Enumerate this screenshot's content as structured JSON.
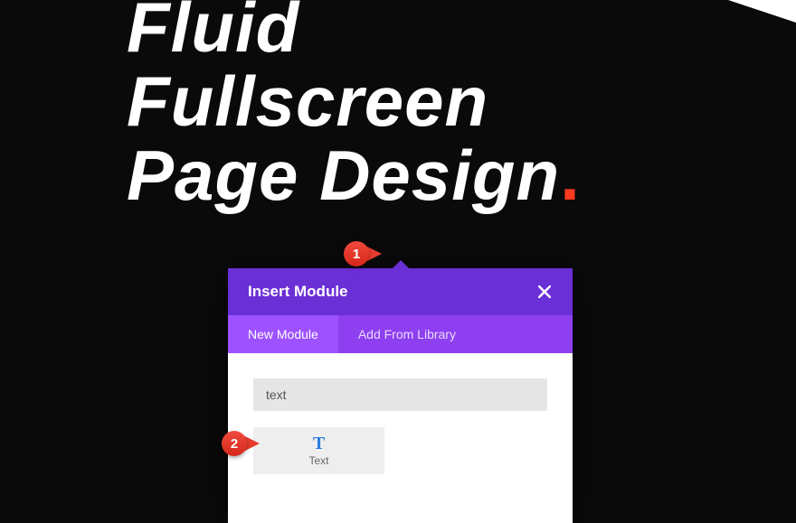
{
  "hero": {
    "line1": "Fluid",
    "line2": "Fullscreen",
    "line3": "Page Design",
    "punct": "."
  },
  "modal": {
    "title": "Insert Module",
    "tabs": {
      "new": "New Module",
      "library": "Add From Library"
    },
    "search_value": "text",
    "modules": {
      "text": {
        "icon": "T",
        "label": "Text"
      }
    }
  },
  "callouts": {
    "c1": "1",
    "c2": "2"
  },
  "colors": {
    "accent_red": "#ff3a1e",
    "modal_header": "#6b2fd6",
    "modal_tabs": "#8e3ff0",
    "modal_tab_active": "#9e52ff",
    "icon_blue": "#2a7de1"
  }
}
